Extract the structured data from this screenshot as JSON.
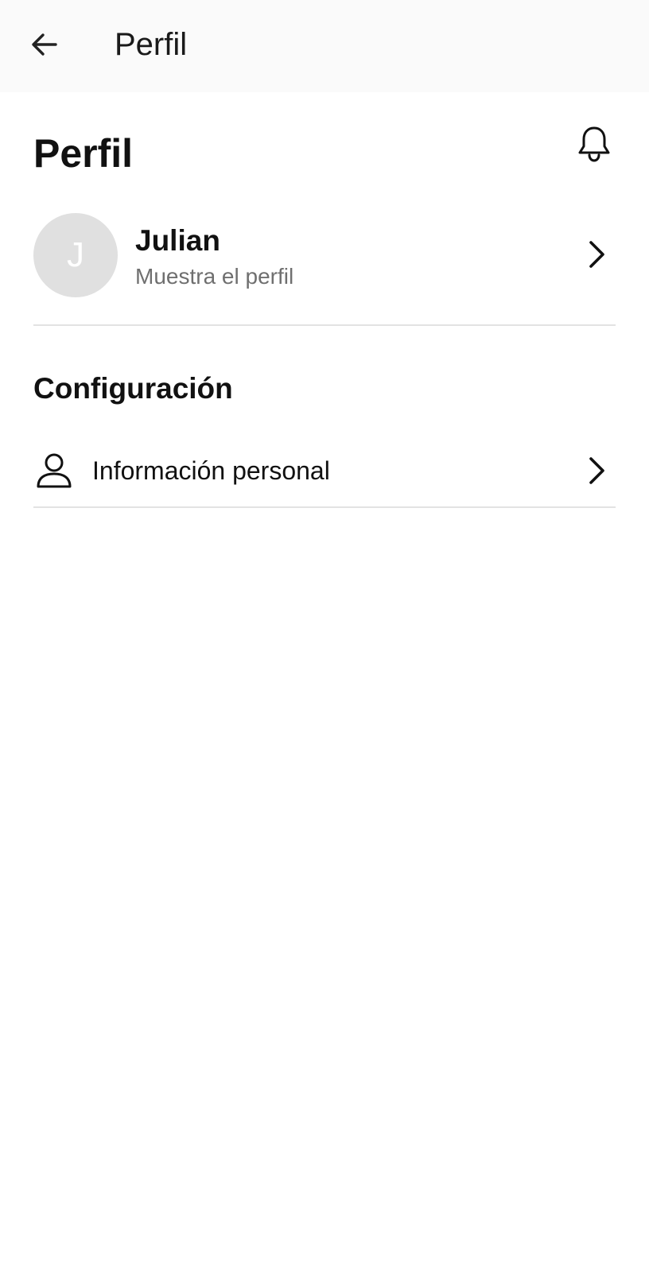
{
  "app_bar": {
    "title": "Perfil",
    "back_icon": "arrow-left-icon"
  },
  "header": {
    "title": "Perfil",
    "notification_icon": "bell-icon"
  },
  "profile": {
    "avatar_initial": "J",
    "name": "Julian",
    "subtitle": "Muestra el perfil",
    "chevron_icon": "chevron-right-icon"
  },
  "settings": {
    "heading": "Configuración",
    "items": [
      {
        "label": "Información personal",
        "icon": "person-icon",
        "chevron_icon": "chevron-right-icon"
      }
    ]
  },
  "colors": {
    "background": "#ffffff",
    "app_bar_background": "#fafafa",
    "text_primary": "#111111",
    "text_secondary": "#6f6f6f",
    "avatar_background": "#e0e0e0",
    "divider": "#e3e3e3"
  }
}
